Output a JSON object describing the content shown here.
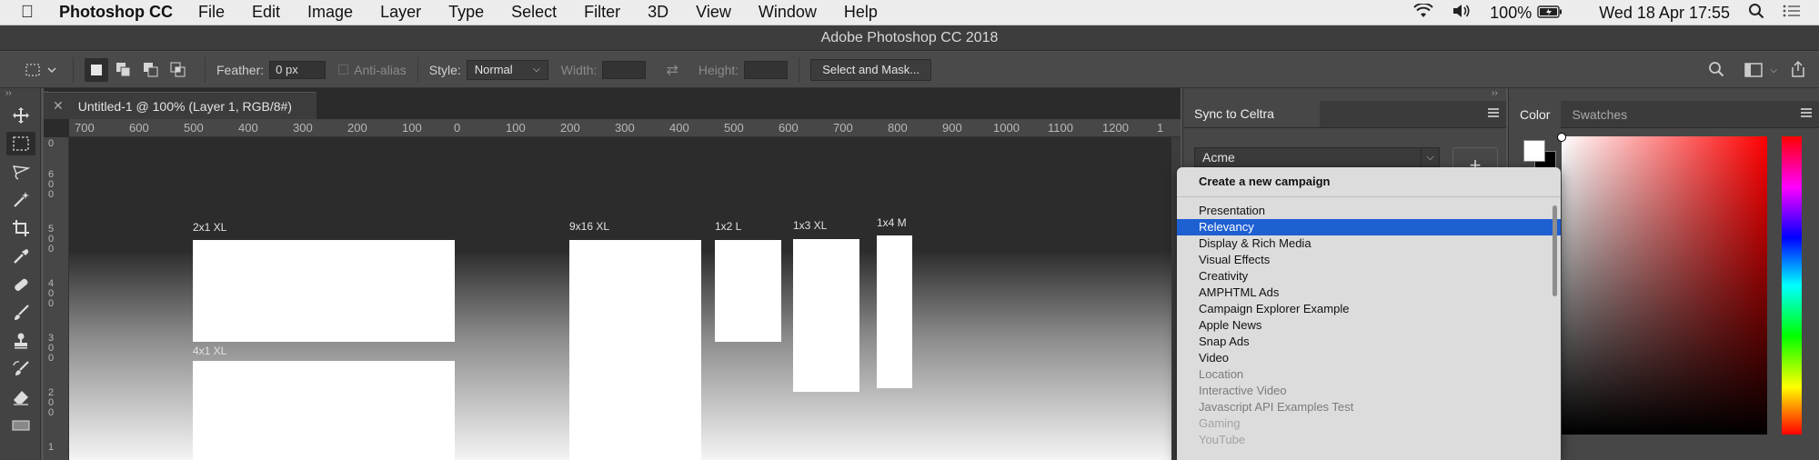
{
  "menubar": {
    "app_name": "Photoshop CC",
    "menus": [
      "File",
      "Edit",
      "Image",
      "Layer",
      "Type",
      "Select",
      "Filter",
      "3D",
      "View",
      "Window",
      "Help"
    ],
    "battery": "100%",
    "datetime": "Wed 18 Apr  17:55"
  },
  "window": {
    "title": "Adobe Photoshop CC 2018"
  },
  "options": {
    "feather_label": "Feather:",
    "feather_value": "0 px",
    "antialias_label": "Anti-alias",
    "style_label": "Style:",
    "style_value": "Normal",
    "width_label": "Width:",
    "height_label": "Height:",
    "select_mask_label": "Select and Mask..."
  },
  "document": {
    "tab_title": "Untitled-1 @ 100% (Layer 1, RGB/8#)",
    "ruler_top": [
      "700",
      "600",
      "500",
      "400",
      "300",
      "200",
      "100",
      "0",
      "100",
      "200",
      "300",
      "400",
      "500",
      "600",
      "700",
      "800",
      "900",
      "1000",
      "1100",
      "1200",
      "1"
    ],
    "ruler_left": [
      [
        "0"
      ],
      [
        "6",
        "0",
        "0"
      ],
      [
        "5",
        "0",
        "0"
      ],
      [
        "4",
        "0",
        "0"
      ],
      [
        "3",
        "0",
        "0"
      ],
      [
        "2",
        "0",
        "0"
      ],
      [
        "1"
      ]
    ],
    "artboards": [
      {
        "label": "2x1 XL"
      },
      {
        "label": "4x1 XL"
      },
      {
        "label": "9x16 XL"
      },
      {
        "label": "1x2 L"
      },
      {
        "label": "1x3 XL"
      },
      {
        "label": "1x4 M"
      }
    ]
  },
  "celtra": {
    "tab_title": "Sync to Celtra",
    "account": "Acme",
    "add_label": "+"
  },
  "dropdown": {
    "create_label": "Create a new campaign",
    "items": [
      {
        "label": "Presentation",
        "state": "normal"
      },
      {
        "label": "Relevancy",
        "state": "selected"
      },
      {
        "label": "Display & Rich Media",
        "state": "normal"
      },
      {
        "label": "Visual Effects",
        "state": "normal"
      },
      {
        "label": "Creativity",
        "state": "normal"
      },
      {
        "label": "AMPHTML Ads",
        "state": "normal"
      },
      {
        "label": "Campaign Explorer Example",
        "state": "normal"
      },
      {
        "label": "Apple News",
        "state": "normal"
      },
      {
        "label": "Snap Ads",
        "state": "normal"
      },
      {
        "label": "Video",
        "state": "normal"
      },
      {
        "label": "Location",
        "state": "faded"
      },
      {
        "label": "Interactive Video",
        "state": "faded"
      },
      {
        "label": "Javascript API Examples Test",
        "state": "faded"
      },
      {
        "label": "Gaming",
        "state": "faded2"
      },
      {
        "label": "YouTube",
        "state": "faded2"
      }
    ]
  },
  "colorpanel": {
    "tabs": [
      "Color",
      "Swatches"
    ],
    "foreground": "#ffffff",
    "background": "#000000"
  }
}
